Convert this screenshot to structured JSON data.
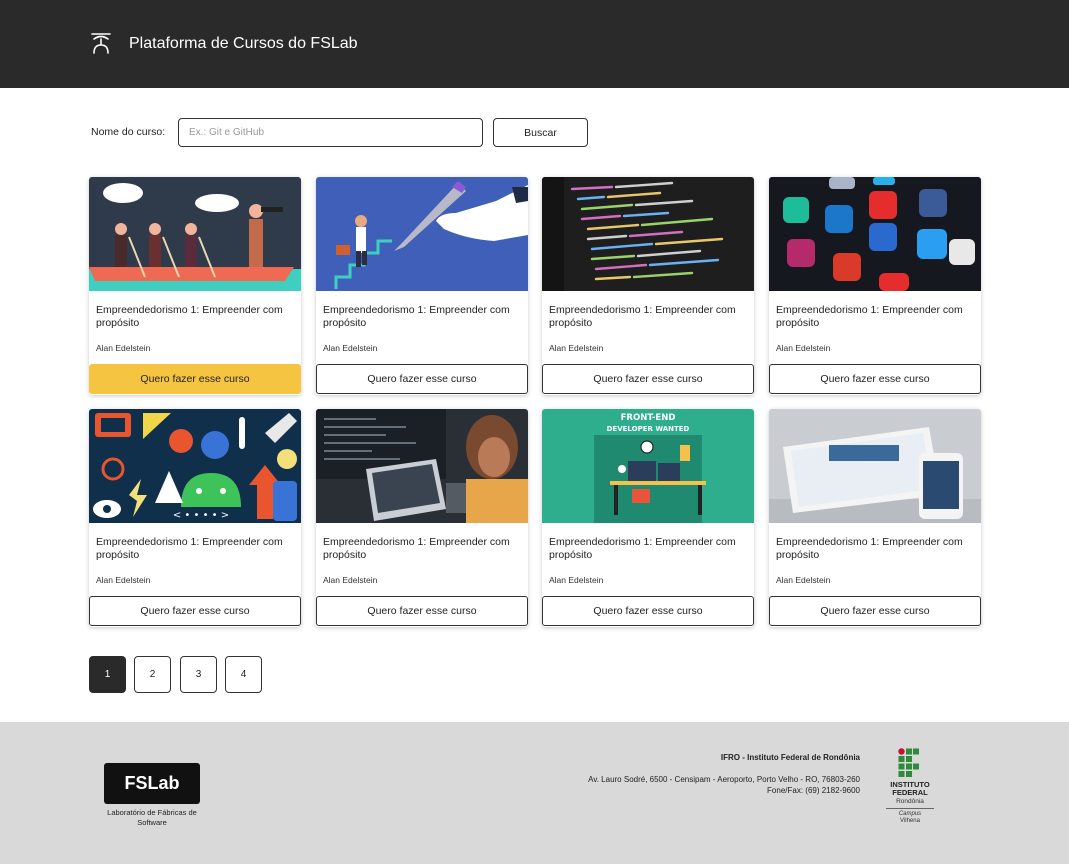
{
  "header": {
    "title": "Plataforma de Cursos do FSLab",
    "logo_icon": "fslab-logo-icon"
  },
  "search": {
    "label": "Nome do curso:",
    "placeholder": "Ex.: Git e GitHub",
    "value": "",
    "button_label": "Buscar"
  },
  "courses": [
    {
      "title": "Empreendedorismo 1: Empreender com propósito",
      "author": "Alan Edelstein",
      "cta": "Quero fazer esse curso",
      "image": "rowing-team-illustration"
    },
    {
      "title": "Empreendedorismo 1: Empreender com propósito",
      "author": "Alan Edelstein",
      "cta": "Quero fazer esse curso",
      "image": "pen-drawing-stairs-illustration"
    },
    {
      "title": "Empreendedorismo 1: Empreender com propósito",
      "author": "Alan Edelstein",
      "cta": "Quero fazer esse curso",
      "image": "code-editor-photo"
    },
    {
      "title": "Empreendedorismo 1: Empreender com propósito",
      "author": "Alan Edelstein",
      "cta": "Quero fazer esse curso",
      "image": "social-media-apps-photo"
    },
    {
      "title": "Empreendedorismo 1: Empreender com propósito",
      "author": "Alan Edelstein",
      "cta": "Quero fazer esse curso",
      "image": "android-icons-illustration"
    },
    {
      "title": "Empreendedorismo 1: Empreender com propósito",
      "author": "Alan Edelstein",
      "cta": "Quero fazer esse curso",
      "image": "developer-at-laptop-photo"
    },
    {
      "title": "Empreendedorismo 1: Empreender com propósito",
      "author": "Alan Edelstein",
      "cta": "Quero fazer esse curso",
      "image": "front-end-developer-wanted-illustration",
      "image_text": [
        "FRONT-END",
        "DEVELOPER WANTED"
      ]
    },
    {
      "title": "Empreendedorismo 1: Empreender com propósito",
      "author": "Alan Edelstein",
      "cta": "Quero fazer esse curso",
      "image": "tablet-and-phone-photo"
    }
  ],
  "pagination": {
    "pages": [
      "1",
      "2",
      "3",
      "4"
    ],
    "current": "1"
  },
  "footer": {
    "fslab_logo": "FSLab",
    "fslab_subtitle": "Laboratório de Fábricas de Software",
    "institution": "IFRO - Instituto Federal de Rondônia",
    "address": "Av. Lauro Sodré, 6500 - Censipam - Aeroporto, Porto Velho - RO, 76803-260",
    "phone": "Fone/Fax: (69) 2182-9600",
    "if_logo": {
      "line1": "INSTITUTO",
      "line2": "FEDERAL",
      "line3": "Rondônia",
      "line4": "Campus",
      "line5": "Vilhena"
    }
  },
  "colors": {
    "header_bg": "#2a2a2a",
    "accent": "#f5c542",
    "footer_bg": "#d9d9d9",
    "if_green": "#2e8b3a",
    "if_red": "#c8102e"
  }
}
